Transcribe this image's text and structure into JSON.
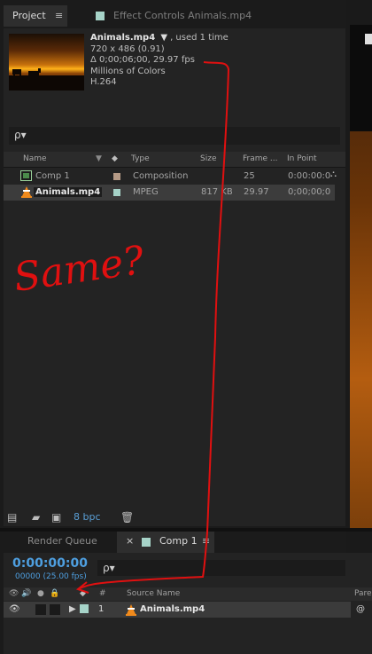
{
  "tabs": {
    "project": "Project",
    "project_menu": "≡",
    "effect_controls": "Effect Controls Animals.mp4"
  },
  "footage_info": {
    "name": "Animals.mp4",
    "arrow": "▼",
    "used": ", used 1 time",
    "resolution": "720 x 486 (0.91)",
    "duration": "Δ 0;00;06;00, 29.97 fps",
    "colors": "Millions of Colors",
    "codec": "H.264"
  },
  "search": {
    "icon": "ρ▾"
  },
  "columns": {
    "name": "Name",
    "type": "Type",
    "size": "Size",
    "frame": "Frame ...",
    "in_point": "In Point"
  },
  "items": [
    {
      "name": "Comp 1",
      "type": "Composition",
      "size": "",
      "frame": "25",
      "in_point": "0:00:00:0"
    },
    {
      "name": "Animals.mp4",
      "type": "MPEG",
      "size": "817 KB",
      "frame": "29.97",
      "in_point": "0;00;00;0"
    }
  ],
  "bottom_bar": {
    "bpc": "8 bpc"
  },
  "annotation": {
    "text": "Same?"
  },
  "timeline_tabs": {
    "render_queue": "Render Queue",
    "close": "×",
    "comp": "Comp 1",
    "menu": "≡"
  },
  "timeline": {
    "timecode": "0:00:00:00",
    "frames": "00000 (25.00 fps)",
    "header": {
      "hash": "#",
      "source_name": "Source Name",
      "parent": "Pare"
    },
    "layer": {
      "number": "1",
      "name": "Animals.mp4"
    }
  },
  "colors": {
    "accent_blue": "#4e9fe0",
    "label_aqua": "#a6d3c8",
    "label_tan": "#b59a86",
    "annotation_red": "#e01010"
  }
}
